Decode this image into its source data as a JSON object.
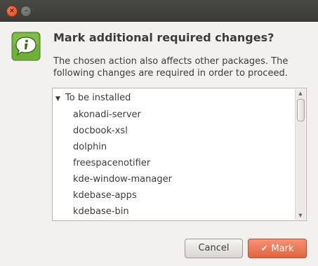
{
  "titlebar": {
    "close_glyph": "×",
    "minimize_glyph": "–"
  },
  "dialog": {
    "icon": "info-icon",
    "heading": "Mark additional required changes?",
    "description_lines": [
      "The chosen action also affects other packages. The",
      "following changes are required in order to proceed."
    ],
    "group_label": "To be installed",
    "packages": [
      "akonadi-server",
      "docbook-xsl",
      "dolphin",
      "freespacenotifier",
      "kde-window-manager",
      "kdebase-apps",
      "kdebase-bin"
    ],
    "cancel_label": "Cancel",
    "mark_label": "Mark"
  },
  "colors": {
    "accent": "#e2643d",
    "info_green": "#6fb03a"
  }
}
